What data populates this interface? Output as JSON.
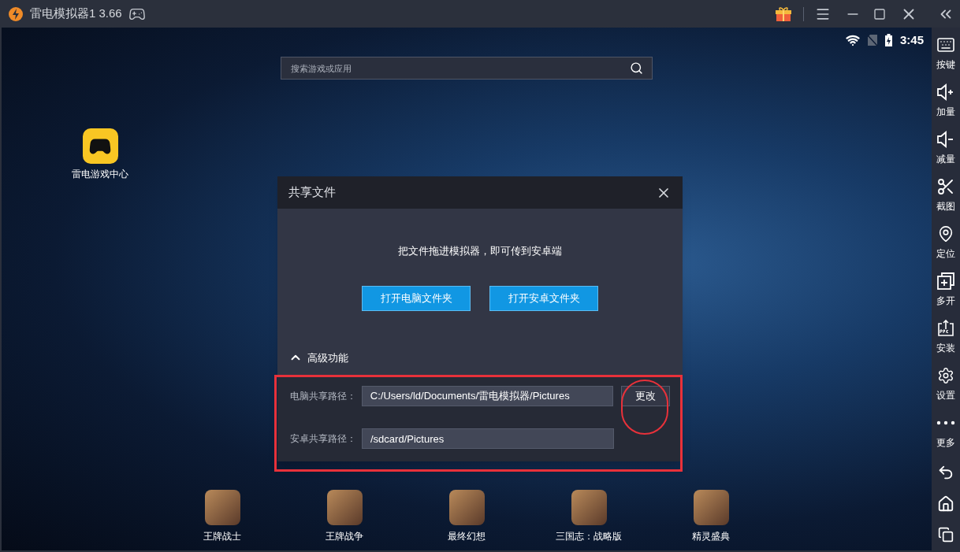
{
  "window": {
    "title": "雷电模拟器1 3.66"
  },
  "status_bar": {
    "time": "3:45"
  },
  "search": {
    "placeholder": "搜索游戏或应用"
  },
  "desktop_apps": [
    {
      "label": "雷电游戏中心"
    }
  ],
  "dock_apps": [
    {
      "label": "王牌战士"
    },
    {
      "label": "王牌战争"
    },
    {
      "label": "最终幻想"
    },
    {
      "label": "三国志：战略版"
    },
    {
      "label": "精灵盛典"
    }
  ],
  "dialog": {
    "title": "共享文件",
    "message": "把文件拖进模拟器，即可传到安卓端",
    "buttons": [
      "打开电脑文件夹",
      "打开安卓文件夹"
    ],
    "advanced": {
      "label": "高级功能",
      "expanded": true
    },
    "fields": [
      {
        "label": "电脑共享路径：",
        "value": "C:/Users/ld/Documents/雷电模拟器/Pictures",
        "action": "更改"
      },
      {
        "label": "安卓共享路径：",
        "value": "/sdcard/Pictures"
      }
    ]
  },
  "sidebar": {
    "items": [
      {
        "label": "按键"
      },
      {
        "label": "加量"
      },
      {
        "label": "减量"
      },
      {
        "label": "截图"
      },
      {
        "label": "定位"
      },
      {
        "label": "多开"
      },
      {
        "label": "安装"
      },
      {
        "label": "设置"
      },
      {
        "label": "更多"
      }
    ]
  }
}
